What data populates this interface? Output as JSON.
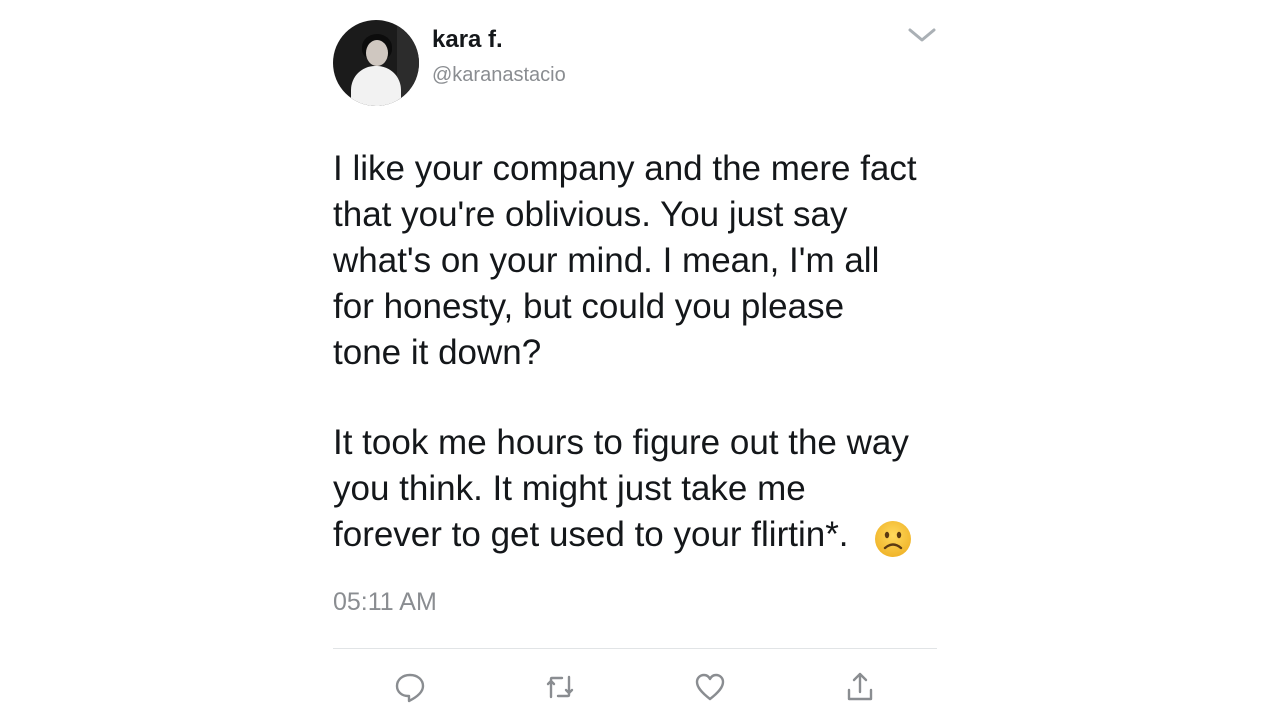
{
  "tweet": {
    "author": {
      "display_name": "kara f.",
      "handle": "@karanastacio"
    },
    "paragraph_1": "I like your company and the mere fact\nthat you're oblivious. You just say\nwhat's on your mind. I mean, I'm all\nfor honesty, but could you please\ntone it down?",
    "paragraph_2": "It took me hours to figure out the way\nyou think. It might just take me\nforever to get used to your flirtin*.",
    "emoji": "frowning-face",
    "timestamp": "05:11 AM"
  },
  "actions": {
    "reply_icon": "speech-bubble-icon",
    "retweet_icon": "retweet-icon",
    "like_icon": "heart-icon",
    "share_icon": "share-icon"
  },
  "colors": {
    "text": "#14171a",
    "secondary_text": "#8a8d91",
    "divider": "#e1e4e6",
    "icon": "#8a8d91",
    "emoji_face": "#f5c542"
  }
}
